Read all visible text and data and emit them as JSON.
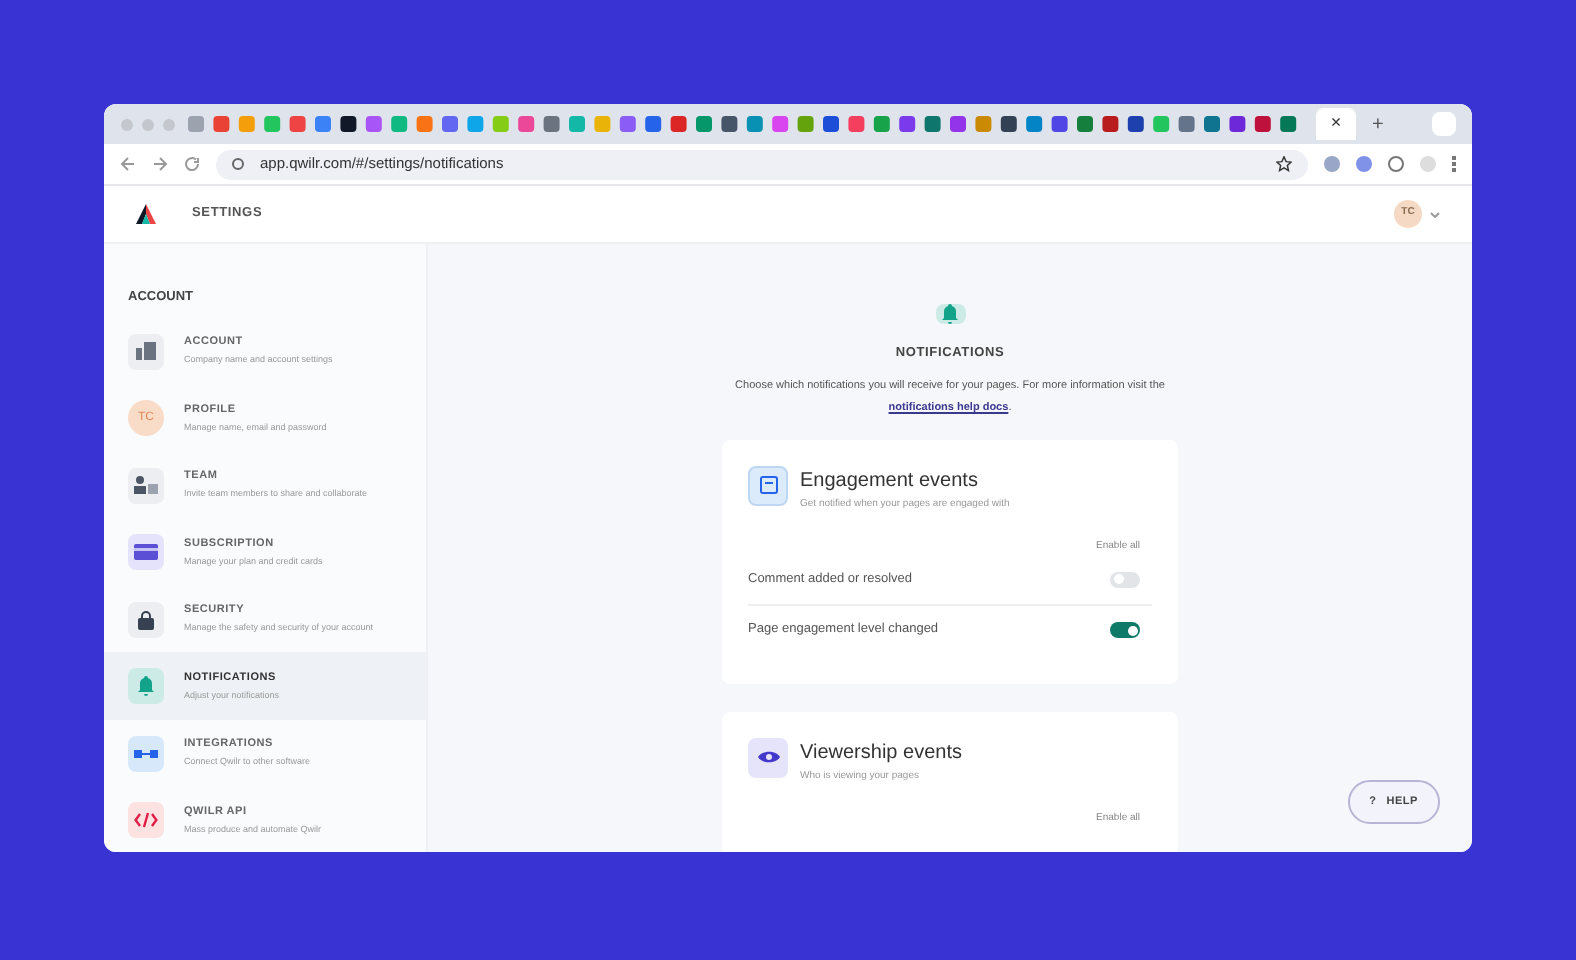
{
  "browser": {
    "address": "app.qwilr.com/#/settings/notifications",
    "tab_close": "×",
    "new_tab": "+"
  },
  "header": {
    "title": "SETTINGS",
    "avatar": "TC"
  },
  "sidebar": {
    "heading": "ACCOUNT",
    "items": [
      {
        "kind": "account",
        "label": "ACCOUNT",
        "description": "Company name and account settings",
        "selected": false
      },
      {
        "kind": "profile",
        "label": "PROFILE",
        "description": "Manage name, email and password",
        "selected": false,
        "initials": "TC"
      },
      {
        "kind": "team",
        "label": "TEAM",
        "description": "Invite team members to share and collaborate",
        "selected": false
      },
      {
        "kind": "subscription",
        "label": "SUBSCRIPTION",
        "description": "Manage your plan and credit cards",
        "selected": false
      },
      {
        "kind": "security",
        "label": "SECURITY",
        "description": "Manage the safety and security of your account",
        "selected": false
      },
      {
        "kind": "notifications",
        "label": "NOTIFICATIONS",
        "description": "Adjust your notifications",
        "selected": true
      },
      {
        "kind": "integrations",
        "label": "INTEGRATIONS",
        "description": "Connect Qwilr to other software",
        "selected": false
      },
      {
        "kind": "api",
        "label": "QWILR API",
        "description": "Mass produce and automate Qwilr",
        "selected": false
      }
    ]
  },
  "page": {
    "title": "NOTIFICATIONS",
    "intro": "Choose which notifications you will receive for your pages. For more information visit the",
    "link": "notifications help docs",
    "link_suffix": "."
  },
  "cards": [
    {
      "kind": "engagement",
      "title": "Engagement events",
      "subtitle": "Get notified when your pages are engaged with",
      "enable_all": "Enable all",
      "rows": [
        {
          "label": "Comment added or resolved",
          "on": false
        },
        {
          "label": "Page engagement level changed",
          "on": true
        }
      ]
    },
    {
      "kind": "viewership",
      "title": "Viewership events",
      "subtitle": "Who is viewing your pages",
      "enable_all": "Enable all"
    }
  ],
  "help": {
    "icon": "?",
    "label": "HELP"
  }
}
